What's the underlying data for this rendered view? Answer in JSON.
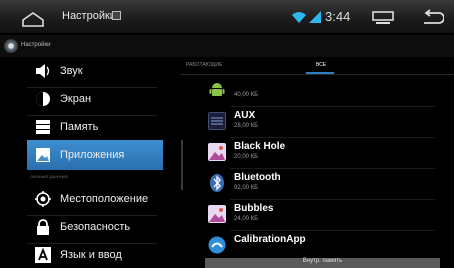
{
  "status_bar": {
    "title": "Настройки",
    "time": "3:44",
    "icons": [
      "home-icon",
      "screenshot-icon",
      "wifi-icon",
      "signal-icon",
      "recent-apps-icon",
      "back-icon"
    ],
    "accent": "#2db6f0"
  },
  "action_bar": {
    "label": "Настройки",
    "icon": "settings-gear-icon"
  },
  "sidebar": {
    "items": [
      {
        "label": "Звук",
        "icon": "sound-icon"
      },
      {
        "label": "Экран",
        "icon": "screen-brightness-icon"
      },
      {
        "label": "Память",
        "icon": "storage-icon"
      },
      {
        "label": "Приложения",
        "icon": "apps-icon",
        "selected": true
      },
      {
        "label": "Местоположение",
        "icon": "location-icon"
      },
      {
        "label": "Безопасность",
        "icon": "lock-icon"
      },
      {
        "label": "Язык и ввод",
        "icon": "language-icon"
      }
    ],
    "section_header": "ЛИЧНЫЕ ДАННЫЕ",
    "selected_color": "#3a8ccc"
  },
  "tabs": [
    {
      "label": "РАБОТАЮЩИЕ",
      "active": false
    },
    {
      "label": "ВСЕ",
      "active": true
    }
  ],
  "apps": [
    {
      "name": "",
      "size": "40,00 КБ",
      "icon": "android-icon"
    },
    {
      "name": "AUX",
      "size": "28,00 КБ",
      "icon": "aux-icon"
    },
    {
      "name": "Black Hole",
      "size": "20,00 КБ",
      "icon": "picture-icon"
    },
    {
      "name": "Bluetooth",
      "size": "92,00 КБ",
      "icon": "bluetooth-icon"
    },
    {
      "name": "Bubbles",
      "size": "24,00 КБ",
      "icon": "picture-icon"
    },
    {
      "name": "CalibrationApp",
      "size": "",
      "icon": "calibration-icon"
    }
  ],
  "storage": {
    "label": "Внутр. память"
  }
}
